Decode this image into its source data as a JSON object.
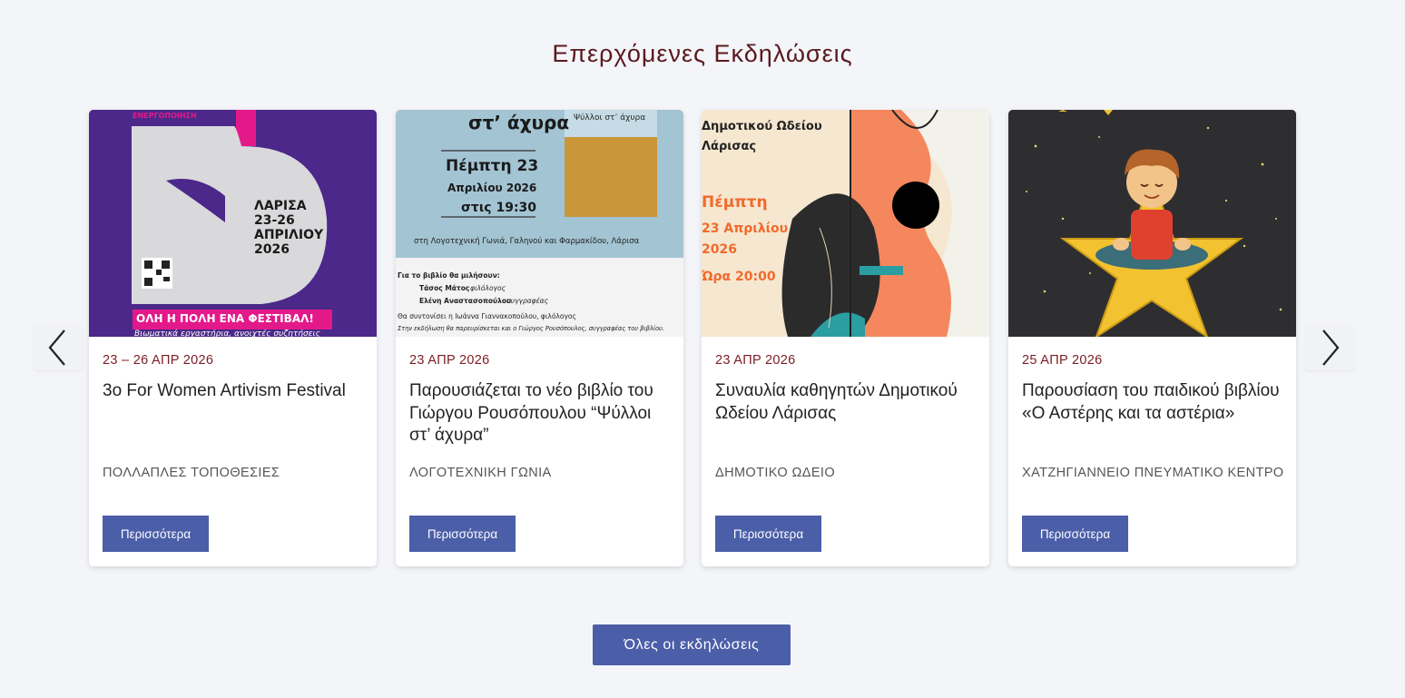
{
  "section": {
    "title": "Επερχόμενες Εκδηλώσεις"
  },
  "carousel": {
    "prev_icon": "chevron-left-icon",
    "next_icon": "chevron-right-icon"
  },
  "events": [
    {
      "date": "23 – 26 ΑΠΡ 2026",
      "title": "3ο For Women Artivism Festival",
      "venue": "ΠΟΛΛΑΠΛΕΣ ΤΟΠΟΘΕΣΙΕΣ",
      "button": "Περισσότερα",
      "poster": {
        "top_text": "ΕΝΕΡΓΟΠΟΙΗΣΗ",
        "city": "ΛΑΡΙΣΑ",
        "dates": "23-26",
        "month": "ΑΠΡΙΛΙΟΥ",
        "year": "2026",
        "banner": "ΟΛΗ Η ΠΟΛΗ ΕΝΑ ΦΕΣΤΙΒΑΛ!",
        "bottom": "Βιωματικά εργαστήρια, ανοιχτές συζητήσεις"
      }
    },
    {
      "date": "23 ΑΠΡ 2026",
      "title": "Παρουσιάζεται το νέο βιβλίο του Γιώργου Ρουσόπουλου “Ψύλλοι στ’ άχυρα”",
      "venue": "ΛΟΓΟΤΕΧΝΙΚΗ ΓΩΝΙΑ",
      "button": "Περισσότερα",
      "poster": {
        "heading": "στ’ άχυρα",
        "day": "Πέμπτη 23",
        "month": "Απριλίου 2026",
        "time": "στις 19:30",
        "book_title": "Ψύλλοι στ’ άχυρα",
        "place": "στη Λογοτεχνική Γωνιά, Γαληνού και Φαρμακίδου, Λάρισα",
        "speakers_heading": "Για το βιβλίο θα μιλήσουν:",
        "speaker1_name": "Τάσος Μάτος",
        "speaker1_role": "φιλόλογος",
        "speaker2_name": "Ελένη Αναστασοπούλου",
        "speaker2_role": "συγγραφέας",
        "coordinator": "Θα συντονίσει η Ιωάννα Γιαννακοπούλου, φιλόλογος",
        "author_note": "Στην εκδήλωση θα παρευρίσκεται και ο Γιώργος Ρουσόπουλος, συγγραφέας του βιβλίου."
      }
    },
    {
      "date": "23 ΑΠΡ 2026",
      "title": "Συναυλία καθηγητών Δημοτικού Ωδείου Λάρισας",
      "venue": "ΔΗΜΟΤΙΚΟ ΩΔΕΙΟ",
      "button": "Περισσότερα",
      "poster": {
        "line1": "Δημοτικού Ωδείου",
        "line2": "Λάρισας",
        "day": "Πέμπτη",
        "month": "23 Απριλίου",
        "year": "2026",
        "time": "Ώρα 20:00"
      }
    },
    {
      "date": "25 ΑΠΡ 2026",
      "title": "Παρουσίαση του παιδικού βιβλίου «Ο Αστέρης και τα αστέρια»",
      "venue": "ΧΑΤΖΗΓΙΑΝΝΕΙΟ ΠΝΕΥΜΑΤΙΚΟ ΚΕΝΤΡΟ",
      "button": "Περισσότερα",
      "poster": {}
    }
  ],
  "footer": {
    "all_events": "Όλες οι εκδηλώσεις"
  }
}
